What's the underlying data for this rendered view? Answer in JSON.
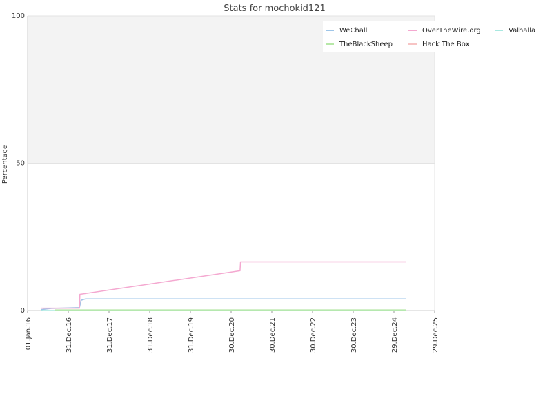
{
  "chart_data": {
    "type": "line",
    "title": "Stats for mochokid121",
    "xlabel": "",
    "ylabel": "Percentage",
    "ylim": [
      0,
      100
    ],
    "xlim": [
      "2016-01-01",
      "2025-12-29"
    ],
    "y_ticks": [
      0,
      50,
      100
    ],
    "x_ticks": [
      "01.Jan.16",
      "31.Dec.16",
      "31.Dec.17",
      "31.Dec.18",
      "31.Dec.19",
      "30.Dec.20",
      "30.Dec.21",
      "30.Dec.22",
      "30.Dec.23",
      "29.Dec.24",
      "29.Dec.25"
    ],
    "x_tick_dates": [
      "2016-01-01",
      "2016-12-31",
      "2017-12-31",
      "2018-12-31",
      "2019-12-31",
      "2020-12-30",
      "2021-12-30",
      "2022-12-30",
      "2023-12-30",
      "2024-12-29",
      "2025-12-29"
    ],
    "grid": true,
    "shaded_band": [
      50,
      100
    ],
    "legend_position": "top-right",
    "series": [
      {
        "name": "WeChall",
        "color": "#9ec5e8",
        "points": [
          [
            "2016-05-01",
            0.3
          ],
          [
            "2016-08-01",
            0.7
          ],
          [
            "2017-04-10",
            1.0
          ],
          [
            "2017-04-25",
            3.5
          ],
          [
            "2017-06-01",
            3.9
          ],
          [
            "2025-04-15",
            3.9
          ]
        ]
      },
      {
        "name": "OverTheWire.org",
        "color": "#f4a8d0",
        "points": [
          [
            "2016-05-01",
            0.8
          ],
          [
            "2017-04-10",
            0.8
          ],
          [
            "2017-04-14",
            5.5
          ],
          [
            "2021-03-20",
            13.5
          ],
          [
            "2021-03-24",
            16.5
          ],
          [
            "2025-04-15",
            16.5
          ]
        ]
      },
      {
        "name": "Valhalla",
        "color": "#a8e8e0",
        "points": [
          [
            "2016-05-01",
            0.0
          ],
          [
            "2025-04-15",
            0.0
          ]
        ]
      },
      {
        "name": "TheBlackSheep",
        "color": "#b7e8a8",
        "points": [
          [
            "2016-09-01",
            0.2
          ],
          [
            "2025-04-15",
            0.2
          ]
        ]
      },
      {
        "name": "Hack The Box",
        "color": "#f7c4c4",
        "points": []
      }
    ]
  }
}
